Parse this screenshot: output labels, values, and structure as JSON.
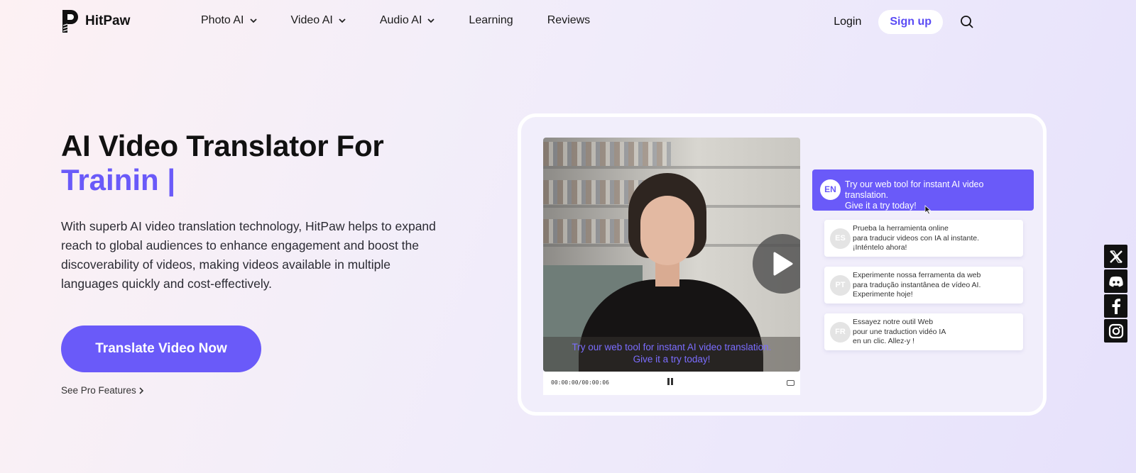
{
  "brand": {
    "name": "HitPaw"
  },
  "nav": {
    "items": [
      {
        "label": "Photo AI",
        "dropdown": true
      },
      {
        "label": "Video AI",
        "dropdown": true
      },
      {
        "label": "Audio AI",
        "dropdown": true
      },
      {
        "label": "Learning",
        "dropdown": false
      },
      {
        "label": "Reviews",
        "dropdown": false
      }
    ],
    "login": "Login",
    "signup": "Sign up"
  },
  "hero": {
    "title_line1": "AI Video Translator For",
    "title_line2": "Trainin |",
    "description": "With superb AI video translation technology, HitPaw helps to expand reach to global audiences to enhance engagement and boost the discoverability of videos, making videos available in multiple languages quickly and cost-effectively.",
    "cta": "Translate Video Now",
    "pro_link": "See Pro Features"
  },
  "demo": {
    "caption_line1": "Try our web tool for instant AI video translation.",
    "caption_line2": "Give it a try today!",
    "time": "00:00:00/00:00:06",
    "active": {
      "code": "EN",
      "line1": "Try our web tool for instant AI video translation.",
      "line2": "Give it a try today!"
    },
    "translations": [
      {
        "code": "ES",
        "lines": [
          "Prueba la herramienta online",
          "para traducir videos con IA al instante.",
          "¡Inténtelo ahora!"
        ]
      },
      {
        "code": "PT",
        "lines": [
          "Experimente nossa ferramenta da web",
          "para tradução instantânea de vídeo AI.",
          "Experimente hoje!"
        ]
      },
      {
        "code": "FR",
        "lines": [
          "Essayez notre outil Web",
          "pour une traduction vidéo IA",
          "en un clic. Allez-y !"
        ]
      }
    ]
  },
  "colors": {
    "accent": "#6a5af9",
    "text": "#111111"
  },
  "social": [
    "x-icon",
    "discord-icon",
    "facebook-icon",
    "instagram-icon"
  ]
}
